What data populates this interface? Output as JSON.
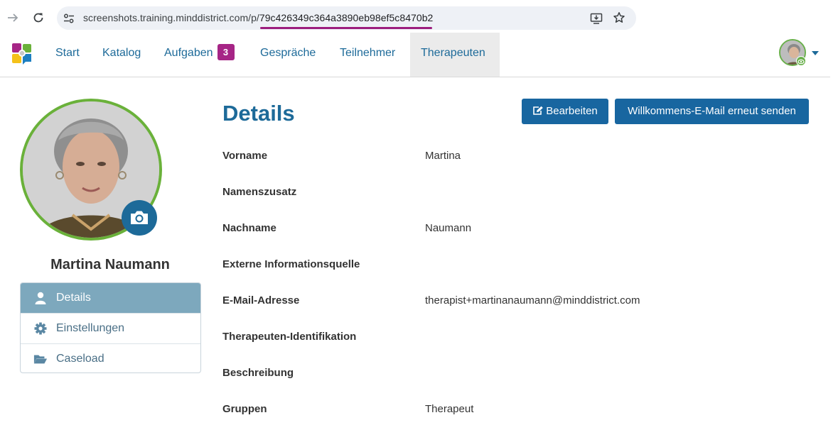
{
  "browser": {
    "url_prefix": "screenshots.training.minddistrict.com/p/",
    "url_hash": "79c426349c364a3890eb98ef5c8470b2",
    "icons": [
      "arrow-forward-icon",
      "reload-icon",
      "site-settings-icon",
      "install-app-icon",
      "bookmark-star-icon"
    ]
  },
  "nav": {
    "items": [
      {
        "label": "Start"
      },
      {
        "label": "Katalog"
      },
      {
        "label": "Aufgaben",
        "badge": "3"
      },
      {
        "label": "Gespräche"
      },
      {
        "label": "Teilnehmer"
      },
      {
        "label": "Therapeuten",
        "active": true
      }
    ]
  },
  "profile": {
    "name": "Martina Naumann"
  },
  "sidebar": {
    "items": [
      {
        "label": "Details",
        "icon": "user-icon",
        "active": true
      },
      {
        "label": "Einstellungen",
        "icon": "gear-icon"
      },
      {
        "label": "Caseload",
        "icon": "folder-open-icon"
      }
    ]
  },
  "main": {
    "title": "Details",
    "edit_button": "Bearbeiten",
    "welcome_button": "Willkommens-E-Mail erneut senden",
    "fields": [
      {
        "label": "Vorname",
        "value": "Martina"
      },
      {
        "label": "Namenszusatz",
        "value": ""
      },
      {
        "label": "Nachname",
        "value": "Naumann"
      },
      {
        "label": "Externe Informationsquelle",
        "value": ""
      },
      {
        "label": "E-Mail-Adresse",
        "value": "therapist+martinanaumann@minddistrict.com"
      },
      {
        "label": "Therapeuten-Identifikation",
        "value": ""
      },
      {
        "label": "Beschreibung",
        "value": ""
      },
      {
        "label": "Gruppen",
        "value": "Therapeut"
      }
    ]
  },
  "colors": {
    "primary": "#1d6a99",
    "badge": "#a62586",
    "avatar_ring": "#6ab13a",
    "sidebar_active": "#7da8bd"
  }
}
